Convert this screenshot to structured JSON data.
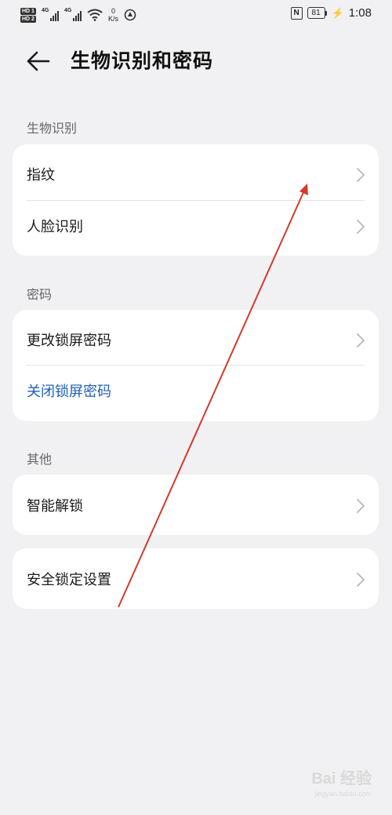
{
  "status_bar": {
    "sim1_label": "HD 1",
    "sim2_label": "HD 2",
    "net1": "4G",
    "net2": "4G",
    "speed_value": "0",
    "speed_unit": "K/s",
    "nfc": "N",
    "battery": "81",
    "time": "1:08"
  },
  "header": {
    "title": "生物识别和密码"
  },
  "sections": {
    "biometrics": {
      "label": "生物识别",
      "items": [
        {
          "label": "指纹"
        },
        {
          "label": "人脸识别"
        }
      ]
    },
    "password": {
      "label": "密码",
      "items": [
        {
          "label": "更改锁屏密码"
        },
        {
          "label": "关闭锁屏密码"
        }
      ]
    },
    "other": {
      "label": "其他",
      "items": [
        {
          "label": "智能解锁"
        },
        {
          "label": "安全锁定设置"
        }
      ]
    }
  },
  "colors": {
    "background": "#f1f1f3",
    "card": "#ffffff",
    "link": "#1f5fb5",
    "annotation_arrow": "#d33a2c"
  },
  "watermark": {
    "brand": "Bai 经验",
    "url": "jingyan.baidu.com"
  }
}
